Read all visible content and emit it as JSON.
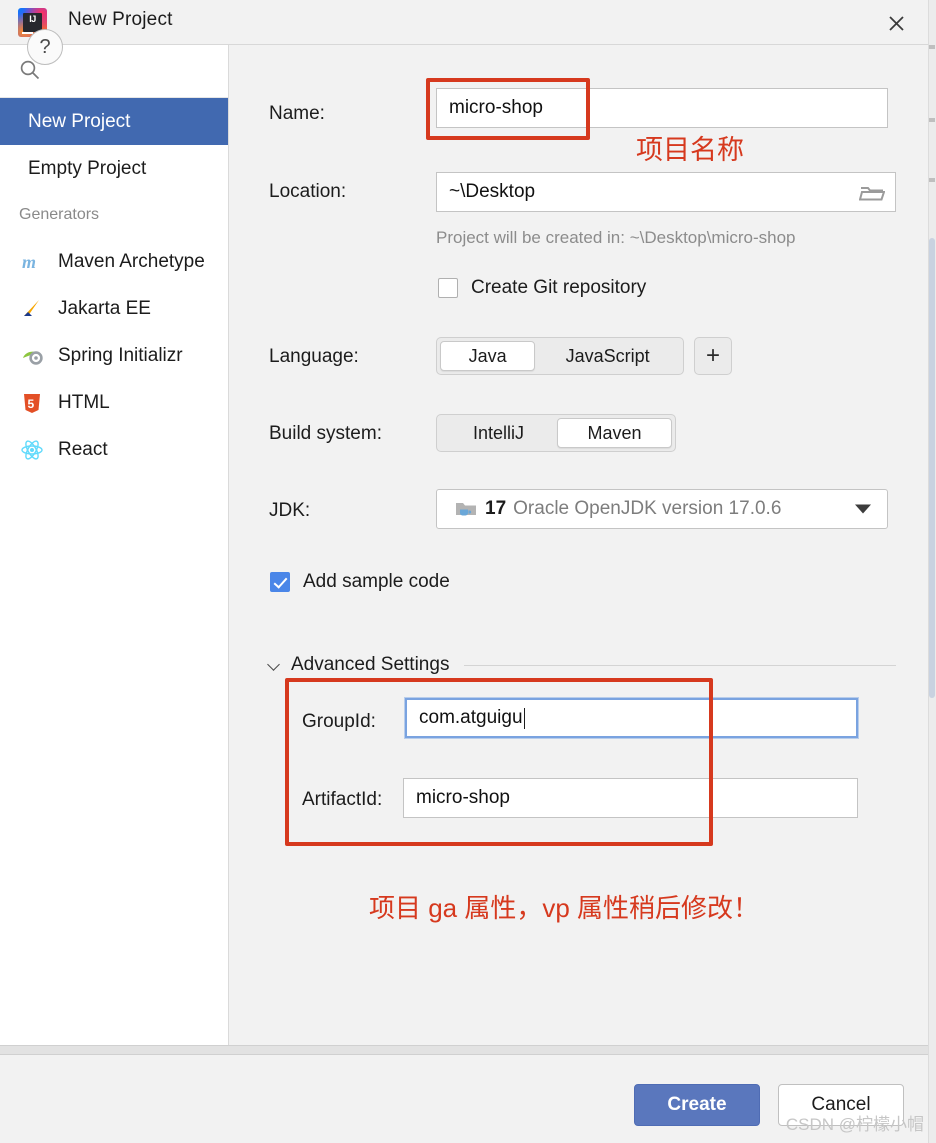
{
  "window": {
    "title": "New Project",
    "logo_letters": "IJ",
    "close_label": "×"
  },
  "sidebar": {
    "search": {
      "value": "",
      "placeholder": ""
    },
    "items": [
      {
        "label": "New Project",
        "selected": true
      },
      {
        "label": "Empty Project",
        "selected": false
      }
    ],
    "generators_header": "Generators",
    "generators": [
      {
        "label": "Maven Archetype",
        "icon": "maven-icon"
      },
      {
        "label": "Jakarta EE",
        "icon": "jakarta-ee-icon"
      },
      {
        "label": "Spring Initializr",
        "icon": "spring-icon"
      },
      {
        "label": "HTML",
        "icon": "html5-icon"
      },
      {
        "label": "React",
        "icon": "react-icon"
      }
    ]
  },
  "form": {
    "name_label": "Name:",
    "name_value": "micro-shop",
    "location_label": "Location:",
    "location_value": "~\\Desktop",
    "location_hint": "Project will be created in: ~\\Desktop\\micro-shop",
    "git_checkbox_label": "Create Git repository",
    "git_checked": false,
    "language_label": "Language:",
    "language_options": [
      "Java",
      "JavaScript"
    ],
    "language_selected": "Java",
    "language_add_label": "+",
    "build_label": "Build system:",
    "build_options": [
      "IntelliJ",
      "Maven"
    ],
    "build_selected": "Maven",
    "jdk_label": "JDK:",
    "jdk_version": "17",
    "jdk_description": "Oracle OpenJDK version 17.0.6",
    "sample_checkbox_label": "Add sample code",
    "sample_checked": true,
    "advanced_title": "Advanced Settings",
    "group_id_label": "GroupId:",
    "group_id_value": "com.atguigu",
    "artifact_id_label": "ArtifactId:",
    "artifact_id_value": "micro-shop"
  },
  "annotations": {
    "name_note": "项目名称",
    "advanced_note": "项目 ga 属性，vp 属性稍后修改！",
    "accent_color": "#d6391e"
  },
  "footer": {
    "help_label": "?",
    "create_label": "Create",
    "cancel_label": "Cancel",
    "watermark": "CSDN @柠檬小帽"
  }
}
